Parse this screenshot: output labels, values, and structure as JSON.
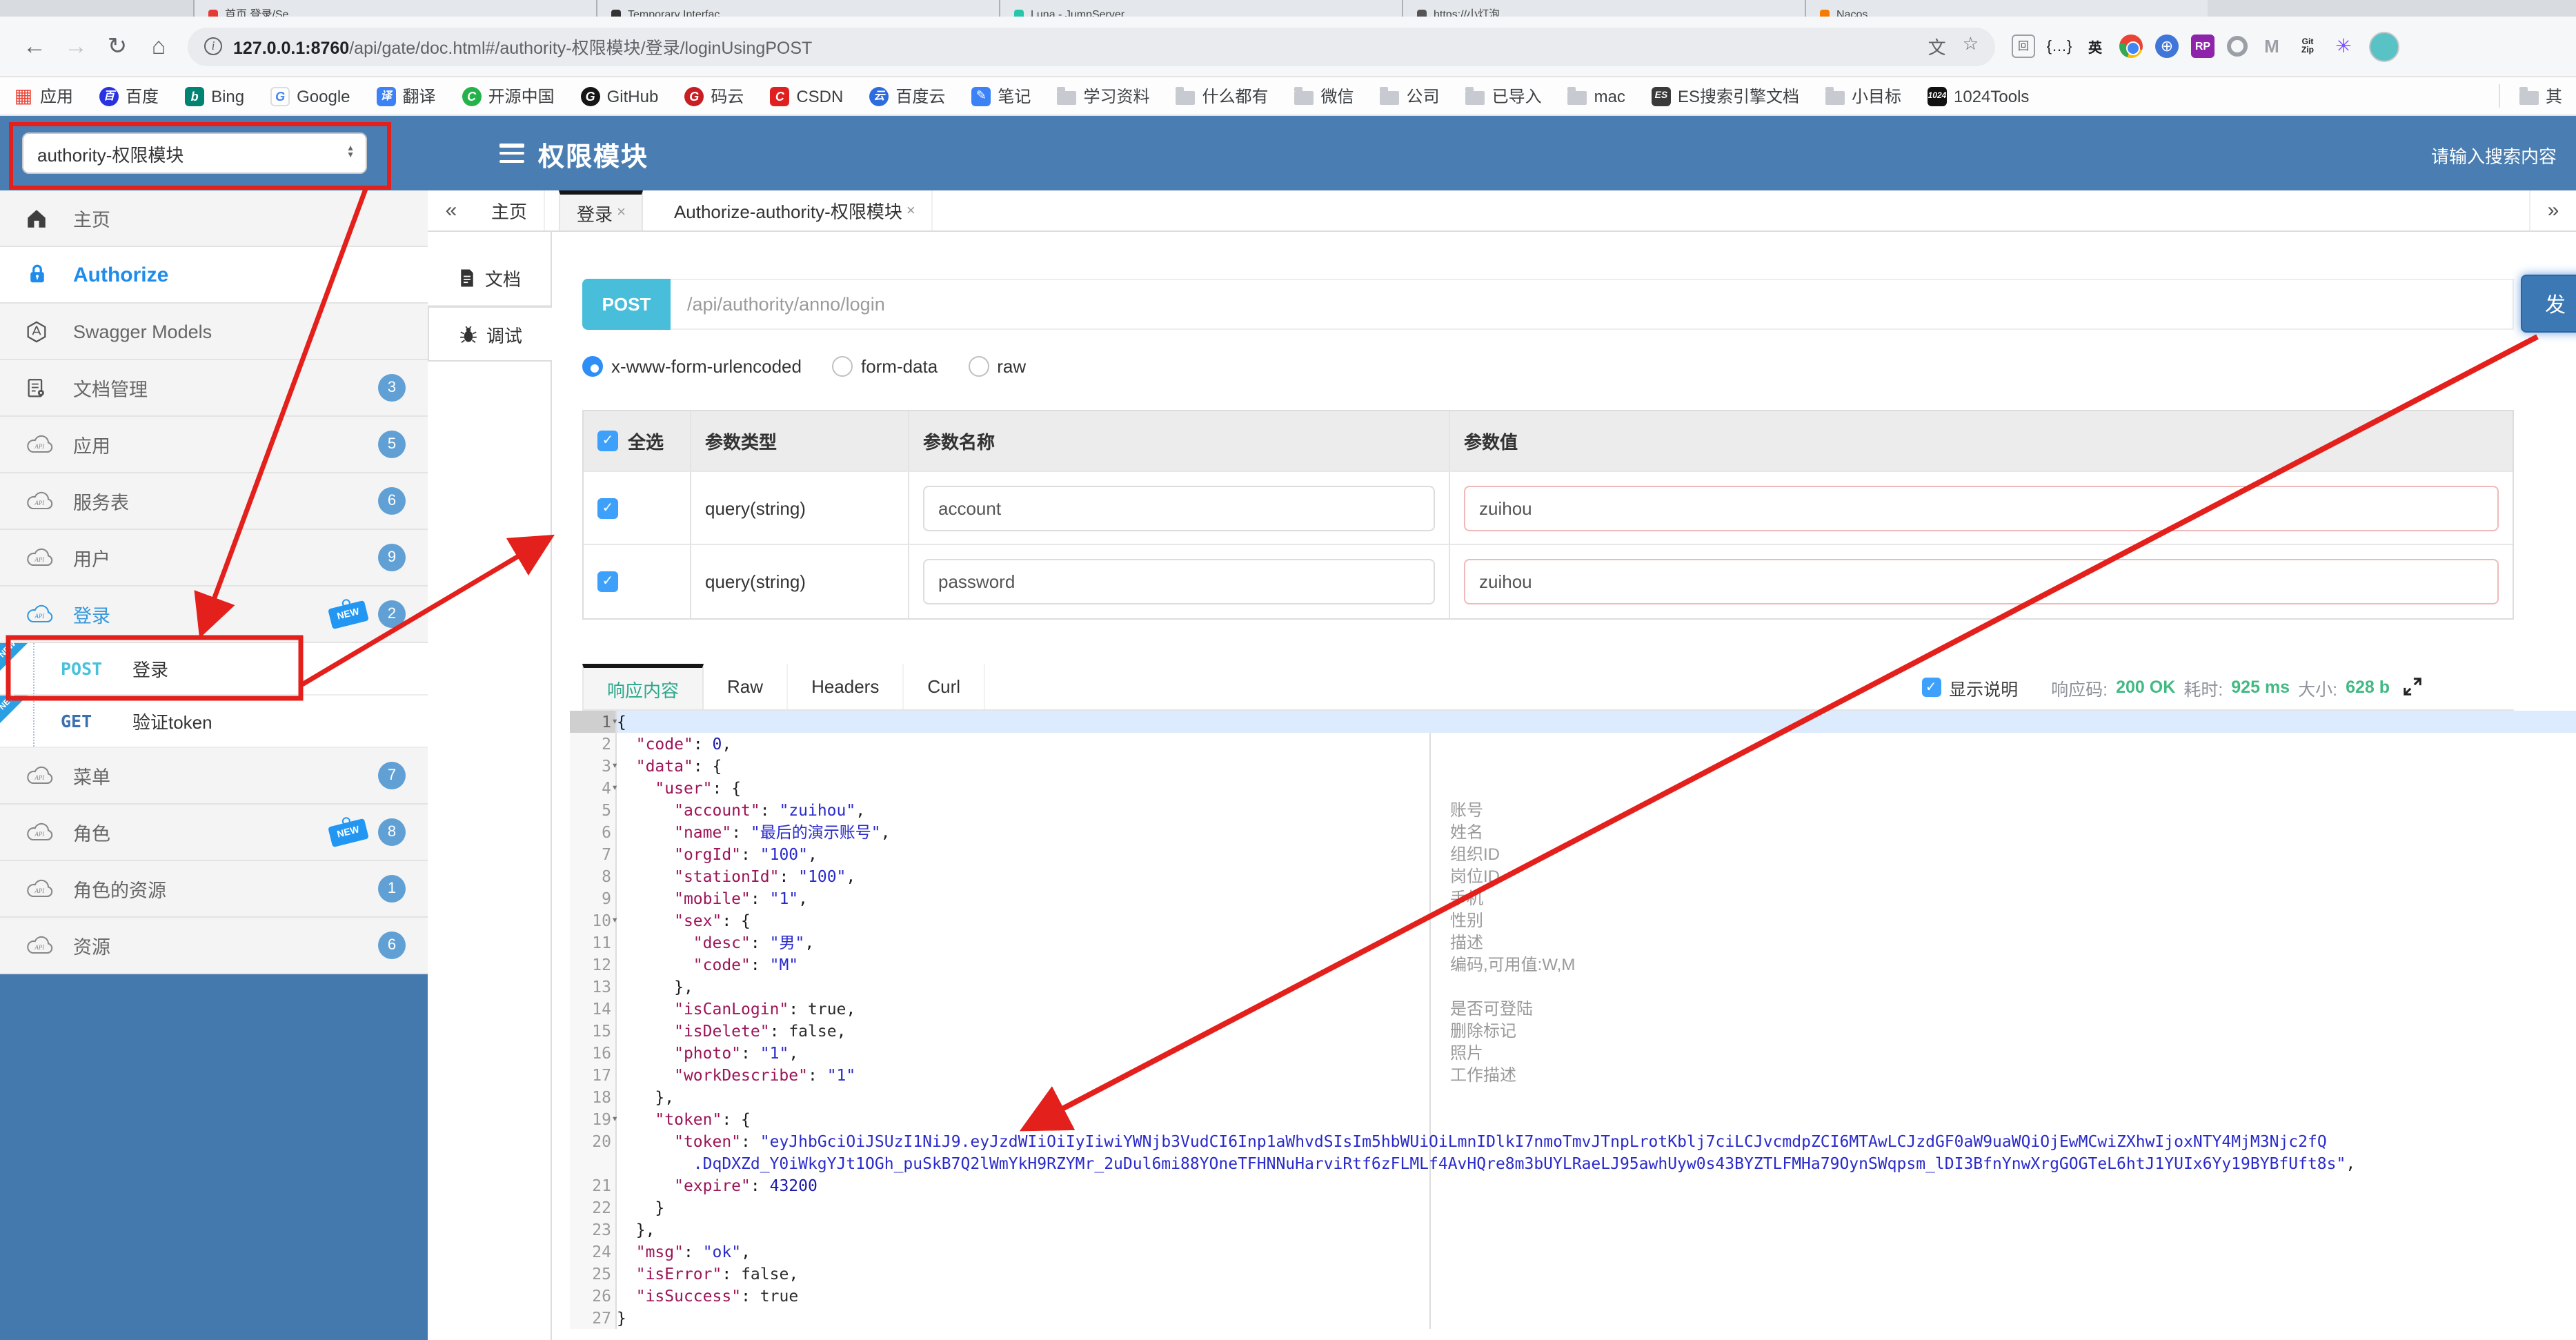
{
  "browser": {
    "tabs": [
      {
        "title": "首页 登录/Se…",
        "color": "#e53935"
      },
      {
        "title": "Temporary Interfac…",
        "color": "#333333"
      },
      {
        "title": "Luna - JumpServer",
        "color": "#26c6aa"
      },
      {
        "title": "https://小灯泡…",
        "color": "#555555"
      },
      {
        "title": "Nacos",
        "color": "#f57c00"
      }
    ],
    "url_host": "127.0.0.1:8760",
    "url_rest": "/api/gate/doc.html#/authority-权限模块/登录/loginUsingPOST",
    "bookmarks": [
      {
        "icon": "apps",
        "label": "应用"
      },
      {
        "icon": "baidu",
        "label": "百度"
      },
      {
        "icon": "bing",
        "label": "Bing"
      },
      {
        "icon": "google",
        "label": "Google"
      },
      {
        "icon": "trans",
        "label": "翻译"
      },
      {
        "icon": "oschina",
        "label": "开源中国"
      },
      {
        "icon": "github",
        "label": "GitHub"
      },
      {
        "icon": "gitee",
        "label": "码云"
      },
      {
        "icon": "csdn",
        "label": "CSDN"
      },
      {
        "icon": "bdyun",
        "label": "百度云"
      },
      {
        "icon": "note",
        "label": "笔记"
      },
      {
        "icon": "folder",
        "label": "学习资料"
      },
      {
        "icon": "folder",
        "label": "什么都有"
      },
      {
        "icon": "folder",
        "label": "微信"
      },
      {
        "icon": "folder",
        "label": "公司"
      },
      {
        "icon": "folder",
        "label": "已导入"
      },
      {
        "icon": "folder",
        "label": "mac"
      },
      {
        "icon": "es",
        "label": "ES搜索引擎文档"
      },
      {
        "icon": "folder",
        "label": "小目标"
      },
      {
        "icon": "tools1024",
        "label": "1024Tools"
      }
    ],
    "other_bookmarks": "其",
    "extensions": [
      "qr",
      "brace",
      "en",
      "chrome",
      "globe",
      "rp",
      "oo",
      "mm",
      "gitzip",
      "star8"
    ]
  },
  "header": {
    "module_select": "authority-权限模块",
    "title": "权限模块",
    "search_placeholder": "请输入搜索内容"
  },
  "sidebar": {
    "items": [
      {
        "label": "主页",
        "icon": "home"
      },
      {
        "label": "Authorize",
        "icon": "lock",
        "kind": "authorize"
      },
      {
        "label": "Swagger Models",
        "icon": "hexagon"
      },
      {
        "label": "文档管理",
        "icon": "docgear",
        "badge": "3"
      },
      {
        "label": "应用",
        "icon": "cloud",
        "badge": "5"
      },
      {
        "label": "服务表",
        "icon": "cloud",
        "badge": "6"
      },
      {
        "label": "用户",
        "icon": "cloud",
        "badge": "9"
      },
      {
        "label": "登录",
        "icon": "cloud",
        "badge": "2",
        "new": true,
        "kind": "active-blue"
      },
      {
        "child": true,
        "method": "POST",
        "label": "登录",
        "new": true
      },
      {
        "child": true,
        "method": "GET",
        "label": "验证token",
        "new": true
      },
      {
        "label": "菜单",
        "icon": "cloud",
        "badge": "7"
      },
      {
        "label": "角色",
        "icon": "cloud",
        "badge": "8",
        "new": true
      },
      {
        "label": "角色的资源",
        "icon": "cloud",
        "badge": "1"
      },
      {
        "label": "资源",
        "icon": "cloud",
        "badge": "6"
      }
    ]
  },
  "doc_tabs": [
    {
      "label": "文档",
      "icon": "doc",
      "active": false
    },
    {
      "label": "调试",
      "icon": "bug",
      "active": true
    }
  ],
  "content_tabs": [
    {
      "label": "主页",
      "closable": false,
      "active": false
    },
    {
      "label": "登录",
      "closable": true,
      "active": true
    },
    {
      "label": "Authorize-authority-权限模块",
      "closable": true,
      "active": false
    }
  ],
  "request": {
    "method": "POST",
    "url": "/api/authority/anno/login",
    "send_label": "发",
    "content_types": [
      "x-www-form-urlencoded",
      "form-data",
      "raw"
    ],
    "selected_type": "x-www-form-urlencoded"
  },
  "params": {
    "headers": [
      "全选",
      "参数类型",
      "参数名称",
      "参数值"
    ],
    "rows": [
      {
        "checked": true,
        "type": "query(string)",
        "name": "account",
        "value": "zuihou"
      },
      {
        "checked": true,
        "type": "query(string)",
        "name": "password",
        "value": "zuihou"
      }
    ]
  },
  "response": {
    "tabs": [
      "响应内容",
      "Raw",
      "Headers",
      "Curl"
    ],
    "active_tab": "响应内容",
    "show_desc_label": "显示说明",
    "code_label": "响应码:",
    "code_value": "200 OK",
    "time_label": "耗时:",
    "time_value": "925 ms",
    "size_label": "大小:",
    "size_value": "628 b"
  },
  "editor": {
    "lines": [
      {
        "n": 1,
        "fold": true,
        "active": true,
        "seg": [
          [
            "p",
            "{"
          ]
        ]
      },
      {
        "n": 2,
        "seg": [
          [
            "w",
            "  "
          ],
          [
            "k",
            "\"code\""
          ],
          [
            "p",
            ": "
          ],
          [
            "n2",
            "0"
          ],
          [
            "p",
            ","
          ]
        ]
      },
      {
        "n": 3,
        "fold": true,
        "seg": [
          [
            "w",
            "  "
          ],
          [
            "k",
            "\"data\""
          ],
          [
            "p",
            ": {"
          ]
        ]
      },
      {
        "n": 4,
        "fold": true,
        "seg": [
          [
            "w",
            "    "
          ],
          [
            "k",
            "\"user\""
          ],
          [
            "p",
            ": {"
          ]
        ]
      },
      {
        "n": 5,
        "ann": "账号",
        "seg": [
          [
            "w",
            "      "
          ],
          [
            "k",
            "\"account\""
          ],
          [
            "p",
            ": "
          ],
          [
            "s",
            "\"zuihou\""
          ],
          [
            "p",
            ","
          ]
        ]
      },
      {
        "n": 6,
        "ann": "姓名",
        "seg": [
          [
            "w",
            "      "
          ],
          [
            "k",
            "\"name\""
          ],
          [
            "p",
            ": "
          ],
          [
            "s",
            "\"最后的演示账号\""
          ],
          [
            "p",
            ","
          ]
        ]
      },
      {
        "n": 7,
        "ann": "组织ID",
        "seg": [
          [
            "w",
            "      "
          ],
          [
            "k",
            "\"orgId\""
          ],
          [
            "p",
            ": "
          ],
          [
            "s",
            "\"100\""
          ],
          [
            "p",
            ","
          ]
        ]
      },
      {
        "n": 8,
        "ann": "岗位ID",
        "seg": [
          [
            "w",
            "      "
          ],
          [
            "k",
            "\"stationId\""
          ],
          [
            "p",
            ": "
          ],
          [
            "s",
            "\"100\""
          ],
          [
            "p",
            ","
          ]
        ]
      },
      {
        "n": 9,
        "ann": "手机",
        "seg": [
          [
            "w",
            "      "
          ],
          [
            "k",
            "\"mobile\""
          ],
          [
            "p",
            ": "
          ],
          [
            "s",
            "\"1\""
          ],
          [
            "p",
            ","
          ]
        ]
      },
      {
        "n": 10,
        "fold": true,
        "ann": "性别",
        "seg": [
          [
            "w",
            "      "
          ],
          [
            "k",
            "\"sex\""
          ],
          [
            "p",
            ": {"
          ]
        ]
      },
      {
        "n": 11,
        "ann": "描述",
        "seg": [
          [
            "w",
            "        "
          ],
          [
            "k",
            "\"desc\""
          ],
          [
            "p",
            ": "
          ],
          [
            "s",
            "\"男\""
          ],
          [
            "p",
            ","
          ]
        ]
      },
      {
        "n": 12,
        "ann": "编码,可用值:W,M",
        "seg": [
          [
            "w",
            "        "
          ],
          [
            "k",
            "\"code\""
          ],
          [
            "p",
            ": "
          ],
          [
            "s",
            "\"M\""
          ]
        ]
      },
      {
        "n": 13,
        "seg": [
          [
            "w",
            "      "
          ],
          [
            "p",
            "},"
          ]
        ]
      },
      {
        "n": 14,
        "ann": "是否可登陆",
        "seg": [
          [
            "w",
            "      "
          ],
          [
            "k",
            "\"isCanLogin\""
          ],
          [
            "p",
            ": "
          ],
          [
            "b",
            "true"
          ],
          [
            "p",
            ","
          ]
        ]
      },
      {
        "n": 15,
        "ann": "删除标记",
        "seg": [
          [
            "w",
            "      "
          ],
          [
            "k",
            "\"isDelete\""
          ],
          [
            "p",
            ": "
          ],
          [
            "b",
            "false"
          ],
          [
            "p",
            ","
          ]
        ]
      },
      {
        "n": 16,
        "ann": "照片",
        "seg": [
          [
            "w",
            "      "
          ],
          [
            "k",
            "\"photo\""
          ],
          [
            "p",
            ": "
          ],
          [
            "s",
            "\"1\""
          ],
          [
            "p",
            ","
          ]
        ]
      },
      {
        "n": 17,
        "ann": "工作描述",
        "seg": [
          [
            "w",
            "      "
          ],
          [
            "k",
            "\"workDescribe\""
          ],
          [
            "p",
            ": "
          ],
          [
            "s",
            "\"1\""
          ]
        ]
      },
      {
        "n": 18,
        "seg": [
          [
            "w",
            "    "
          ],
          [
            "p",
            "},"
          ]
        ]
      },
      {
        "n": 19,
        "fold": true,
        "seg": [
          [
            "w",
            "    "
          ],
          [
            "k",
            "\"token\""
          ],
          [
            "p",
            ": {"
          ]
        ]
      },
      {
        "n": 20,
        "seg": [
          [
            "w",
            "      "
          ],
          [
            "k",
            "\"token\""
          ],
          [
            "p",
            ": "
          ],
          [
            "s",
            "\"eyJhbGciOiJSUzI1NiJ9.eyJzdWIiOiIyIiwiYWNjb3VudCI6Inp1aWhvdSIsIm5hbWUiOiLmnIDlkI7nmoTmvJTnpLrotKblj7ciLCJvcmdpZCI6MTAwLCJzdGF0aW9uaWQiOjEwMCwiZXhwIjoxNTY4MjM3Njc2fQ"
          ]
        ],
        "wrap": [
          [
            "w",
            "        "
          ],
          [
            "s",
            ".DqDXZd_Y0iWkgYJt1OGh_puSkB7Q2lWmYkH9RZYMr_2uDul6mi88YOneTFHNNuHarviRtf6zFLMLf4AvHQre8m3bUYLRaeLJ95awhUyw0s43BYZTLFMHa79OynSWqpsm_lDI3BfnYnwXrgGOGTeL6htJ1YUIx6Yy19BYBfUft8s\""
          ],
          [
            "p",
            ","
          ]
        ]
      },
      {
        "n": 21,
        "seg": [
          [
            "w",
            "      "
          ],
          [
            "k",
            "\"expire\""
          ],
          [
            "p",
            ": "
          ],
          [
            "n2",
            "43200"
          ]
        ]
      },
      {
        "n": 22,
        "seg": [
          [
            "w",
            "    "
          ],
          [
            "p",
            "}"
          ]
        ]
      },
      {
        "n": 23,
        "seg": [
          [
            "w",
            "  "
          ],
          [
            "p",
            "},"
          ]
        ]
      },
      {
        "n": 24,
        "seg": [
          [
            "w",
            "  "
          ],
          [
            "k",
            "\"msg\""
          ],
          [
            "p",
            ": "
          ],
          [
            "s",
            "\"ok\""
          ],
          [
            "p",
            ","
          ]
        ]
      },
      {
        "n": 25,
        "seg": [
          [
            "w",
            "  "
          ],
          [
            "k",
            "\"isError\""
          ],
          [
            "p",
            ": "
          ],
          [
            "b",
            "false"
          ],
          [
            "p",
            ","
          ]
        ]
      },
      {
        "n": 26,
        "seg": [
          [
            "w",
            "  "
          ],
          [
            "k",
            "\"isSuccess\""
          ],
          [
            "p",
            ": "
          ],
          [
            "b",
            "true"
          ]
        ]
      },
      {
        "n": 27,
        "seg": [
          [
            "p",
            "}"
          ]
        ]
      }
    ]
  },
  "colors": {
    "header_blue": "#4a7eb2",
    "method_cyan": "#49bedb",
    "status_green": "#42b983",
    "annotation_red": "#e3201b",
    "badge_blue": "#61a0d4"
  }
}
